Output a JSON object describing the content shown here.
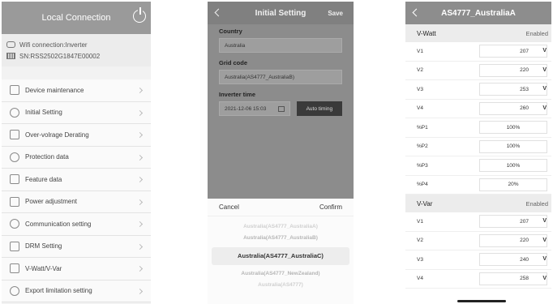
{
  "local": {
    "title": "Local Connection",
    "wifi_text": "Wifi connection:Inverter",
    "sn_text": "SN:RSS2502G1847E00002",
    "menu": [
      {
        "label": "Device maintenance",
        "icon": "wrench-icon"
      },
      {
        "label": "Initial Setting",
        "icon": "user-setting-icon"
      },
      {
        "label": "Over-volrage Derating",
        "icon": "lamp-icon"
      },
      {
        "label": "Protection data",
        "icon": "shield-icon"
      },
      {
        "label": "Feature data",
        "icon": "box-icon"
      },
      {
        "label": "Power adjustment",
        "icon": "adjust-icon"
      },
      {
        "label": "Communication setting",
        "icon": "antenna-icon"
      },
      {
        "label": "DRM Setting",
        "icon": "drm-icon"
      },
      {
        "label": "V-Watt/V-Var",
        "icon": "chart-icon"
      },
      {
        "label": "Export limitation setting",
        "icon": "export-icon"
      }
    ]
  },
  "initial": {
    "title": "Initial Setting",
    "save_label": "Save",
    "country_label": "Country",
    "country_value": "Australia",
    "grid_code_label": "Grid code",
    "grid_code_value": "Australia(AS4777_AustraliaB)",
    "inverter_time_label": "Inverter time",
    "inverter_time_value": "2021-12-06 15:03",
    "auto_timing_label": "Auto timing",
    "cancel_label": "Cancel",
    "confirm_label": "Confirm",
    "picker": {
      "far_above": "Australia(AS4777_AustraliaA)",
      "above": "Australia(AS4777_AustraliaB)",
      "selected": "Australia(AS4777_AustraliaC)",
      "below": "Australia(AS4777_NewZealand)",
      "far_below": "Australia(AS4777)"
    }
  },
  "as4777": {
    "title": "AS4777_AustraliaA",
    "vwatt": {
      "label": "V-Watt",
      "status": "Enabled",
      "rows": [
        {
          "name": "V1",
          "value": "207",
          "unit": "V"
        },
        {
          "name": "V2",
          "value": "220",
          "unit": "V"
        },
        {
          "name": "V3",
          "value": "253",
          "unit": "V"
        },
        {
          "name": "V4",
          "value": "260",
          "unit": "V"
        },
        {
          "name": "%P1",
          "value": "100%",
          "unit": ""
        },
        {
          "name": "%P2",
          "value": "100%",
          "unit": ""
        },
        {
          "name": "%P3",
          "value": "100%",
          "unit": ""
        },
        {
          "name": "%P4",
          "value": "20%",
          "unit": ""
        }
      ]
    },
    "vvar": {
      "label": "V-Var",
      "status": "Enabled",
      "rows": [
        {
          "name": "V1",
          "value": "207",
          "unit": "V"
        },
        {
          "name": "V2",
          "value": "220",
          "unit": "V"
        },
        {
          "name": "V3",
          "value": "240",
          "unit": "V"
        },
        {
          "name": "V4",
          "value": "258",
          "unit": "V"
        }
      ]
    }
  }
}
